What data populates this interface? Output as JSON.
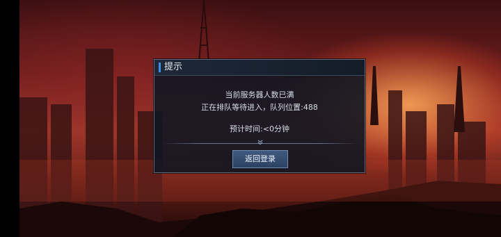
{
  "dialog": {
    "title": "提示",
    "message_line1": "当前服务器人数已满",
    "message_line2": "正在排队等待进入，队列位置:488",
    "estimated_time": "预计时间:<0分钟",
    "return_button_label": "返回登录",
    "divider_icon": "double-chevron-down-icon"
  },
  "colors": {
    "title_accent": "#3d8fe6",
    "dialog_background": "#0e1622",
    "button_background": "#3f5a7f"
  }
}
